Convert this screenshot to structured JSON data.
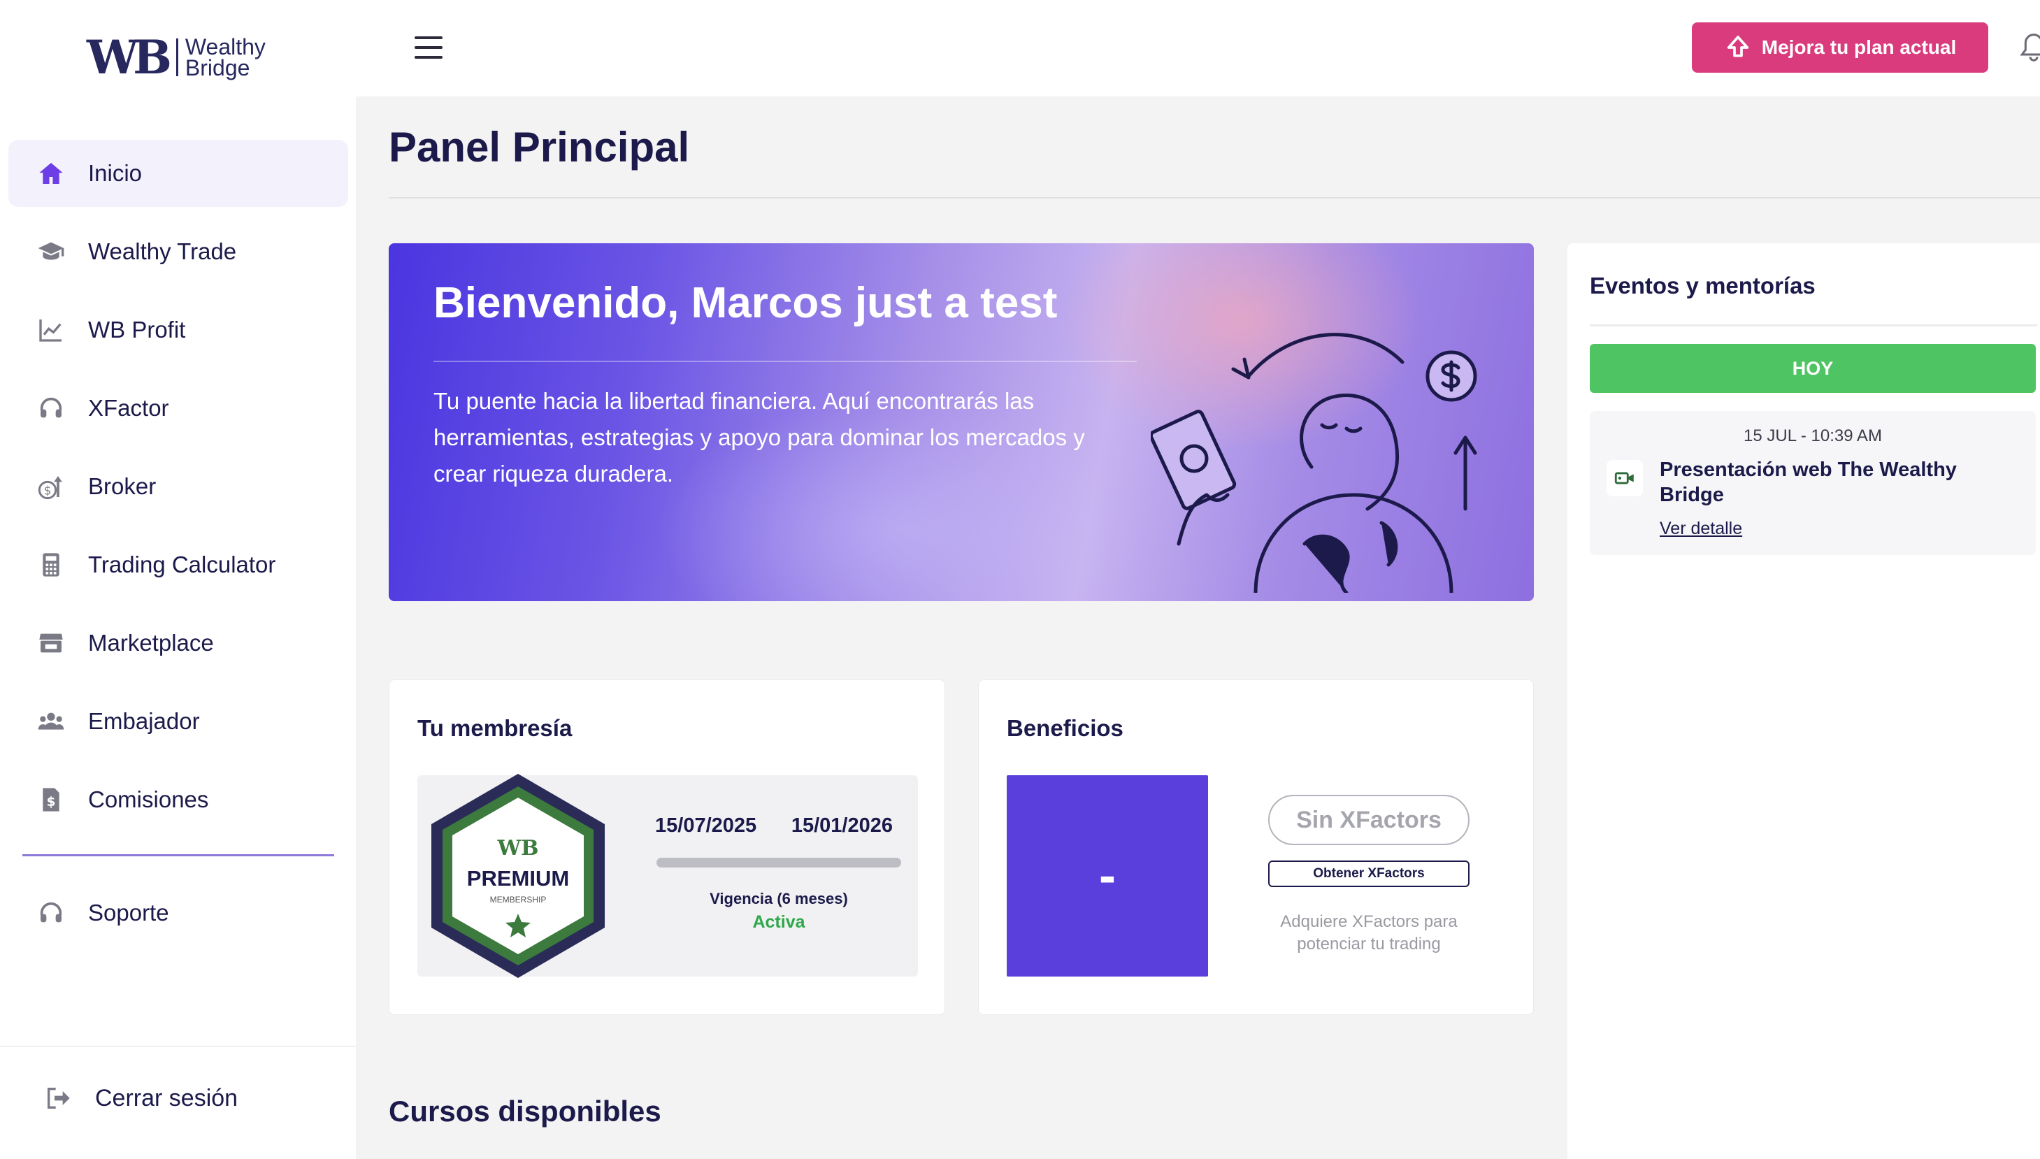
{
  "brand": {
    "mark": "WB",
    "name_line1": "Wealthy",
    "name_line2": "Bridge"
  },
  "sidebar": {
    "items": [
      {
        "label": "Inicio",
        "icon": "home-icon",
        "active": true
      },
      {
        "label": "Wealthy Trade",
        "icon": "graduation-cap-icon"
      },
      {
        "label": "WB Profit",
        "icon": "line-chart-icon"
      },
      {
        "label": "XFactor",
        "icon": "headset-icon"
      },
      {
        "label": "Broker",
        "icon": "dollar-growth-icon"
      },
      {
        "label": "Trading Calculator",
        "icon": "calculator-icon"
      },
      {
        "label": "Marketplace",
        "icon": "store-icon"
      },
      {
        "label": "Embajador",
        "icon": "users-icon"
      },
      {
        "label": "Comisiones",
        "icon": "dollar-file-icon"
      }
    ],
    "support": {
      "label": "Soporte",
      "icon": "headset-icon"
    },
    "logout": {
      "label": "Cerrar sesión",
      "icon": "logout-icon"
    }
  },
  "header": {
    "upgrade_label": "Mejora tu plan actual",
    "colors": {
      "upgrade": "#d93b7d",
      "accent": "#5a3fdc"
    }
  },
  "main": {
    "title": "Panel Principal",
    "hero": {
      "title": "Bienvenido, Marcos just a test",
      "text": "Tu puente hacia la libertad financiera. Aquí encontrarás las herramientas, estrategias y apoyo para dominar los mercados y crear riqueza duradera."
    },
    "membership": {
      "title": "Tu membresía",
      "badge_brand": "WB",
      "badge_label": "PREMIUM",
      "badge_sub": "MEMBERSHIP",
      "start_date": "15/07/2025",
      "end_date": "15/01/2026",
      "validity": "Vigencia (6 meses)",
      "status": "Activa",
      "progress": 1.0
    },
    "benefits": {
      "title": "Beneficios",
      "tile_value": "-",
      "xfactors_label": "Sin XFactors",
      "get_button": "Obtener XFactors",
      "description": "Adquiere XFactors para potenciar tu trading"
    },
    "courses_title": "Cursos disponibles"
  },
  "events": {
    "title": "Eventos y mentorías",
    "today_label": "HOY",
    "items": [
      {
        "date": "15 JUL - 10:39 AM",
        "name": "Presentación web The Wealthy Bridge",
        "link": "Ver detalle"
      }
    ]
  }
}
